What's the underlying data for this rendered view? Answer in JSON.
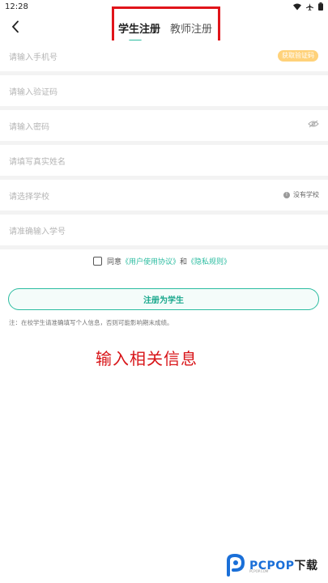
{
  "status": {
    "time": "12:28"
  },
  "tabs": [
    {
      "label": "学生注册",
      "active": true
    },
    {
      "label": "教师注册",
      "active": false
    }
  ],
  "form": {
    "phone_placeholder": "请输入手机号",
    "get_code_label": "获取验证码",
    "code_placeholder": "请输入验证码",
    "password_placeholder": "请输入密码",
    "name_placeholder": "请填写真实姓名",
    "school_placeholder": "请选择学校",
    "no_school_label": "没有学校",
    "student_id_placeholder": "请准确输入学号"
  },
  "agreement": {
    "prefix": "同意",
    "user_agreement": "《用户使用协议》",
    "and": "和",
    "privacy": "《隐私规则》"
  },
  "register_button": "注册为学生",
  "note": "注：在校学生请准确填写个人信息，否则可能影响期末成绩。",
  "caption": "输入相关信息",
  "watermark": {
    "brand": "PCPOP",
    "suffix": "下载",
    "sub": "PCPOP.COM"
  },
  "colors": {
    "accent": "#2bbca0",
    "highlight_box": "#e0141a",
    "code_button": "#ffd27a",
    "caption": "#d81418"
  }
}
